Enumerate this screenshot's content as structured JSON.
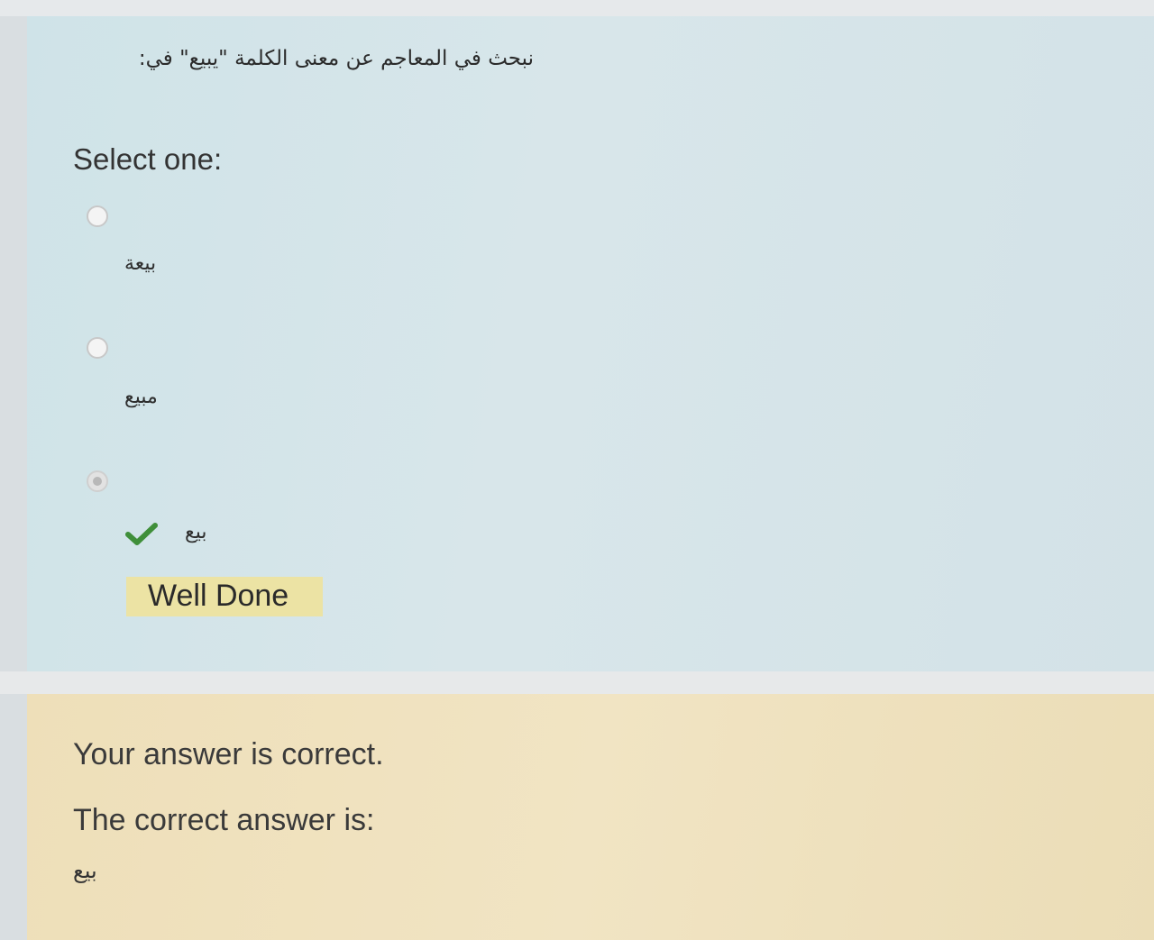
{
  "question": {
    "text": "نبحث في المعاجم عن معنى الكلمة \"يبيع\" في:",
    "prompt": "Select one:"
  },
  "options": [
    {
      "label": "بيعة",
      "selected": false
    },
    {
      "label": "مبيع",
      "selected": false
    },
    {
      "label": "بيع",
      "selected": true,
      "correct": true
    }
  ],
  "option_feedback": {
    "icon": "check-icon",
    "text": "Well Done"
  },
  "feedback": {
    "result": "Your answer is correct.",
    "correct_label": "The correct answer is:",
    "correct_answer": "بيع"
  },
  "colors": {
    "question_bg": "#d3e2e7",
    "feedback_bg": "#efe0bc",
    "well_done_bg": "#ece3a4",
    "check_green": "#3f8f3a"
  }
}
